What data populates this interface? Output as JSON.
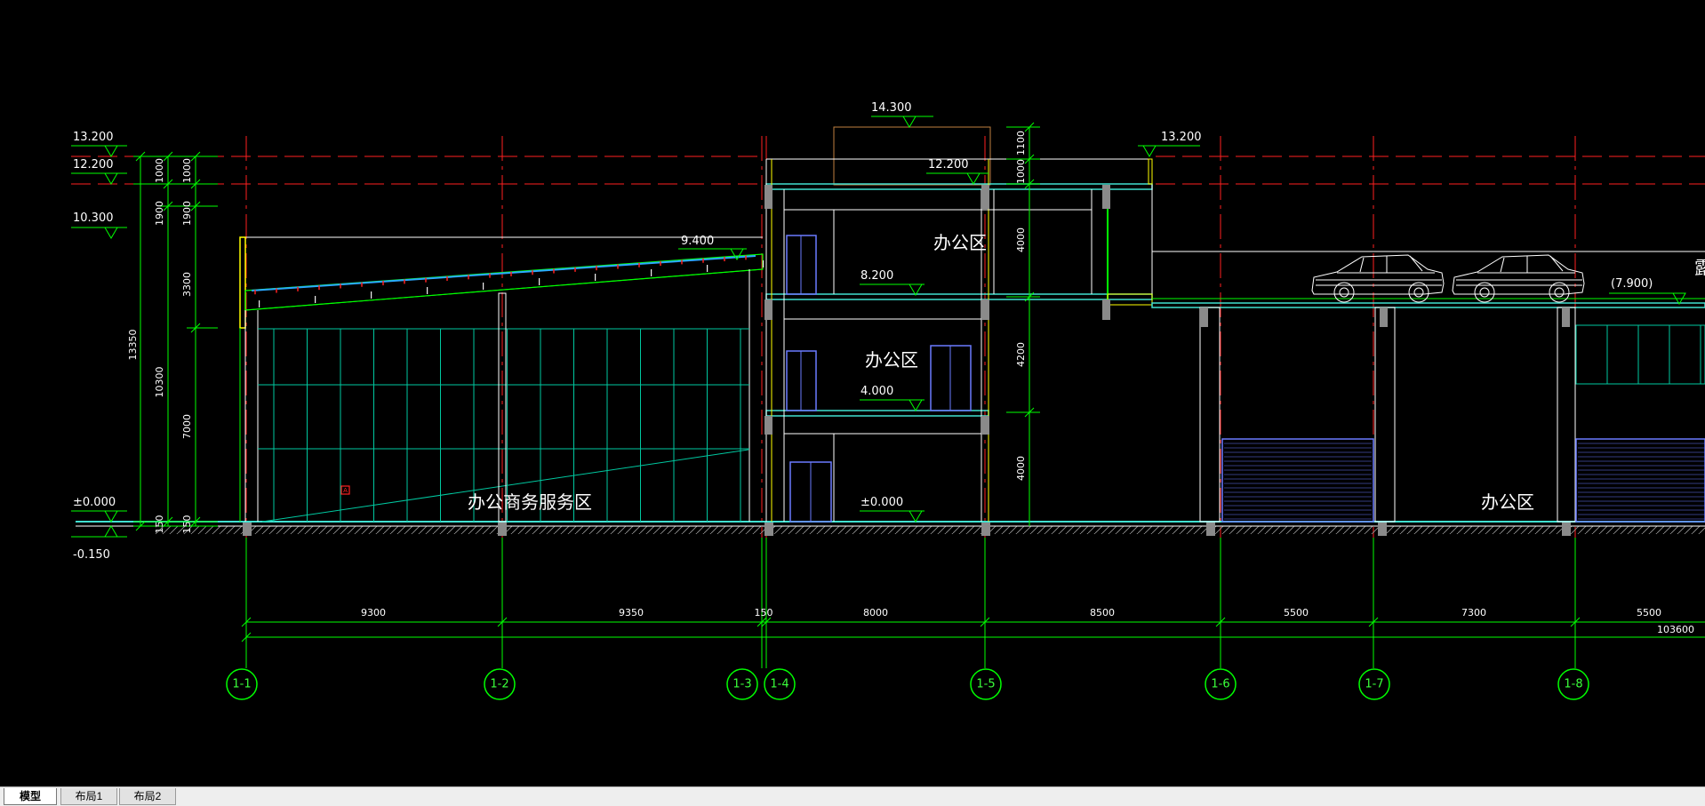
{
  "colors": {
    "background": "#000000",
    "axis_line": "#ff2020",
    "dim_line": "#00ff00",
    "wall": "#ffffff",
    "slab": "#40e0d0",
    "glazing": "#00c8a0",
    "window": "#6a7bff",
    "roof_beam": "#ffff00"
  },
  "levels": {
    "l_13200": "13.200",
    "l_12200": "12.200",
    "l_10300": "10.300",
    "l_0000": "±0.000",
    "l_m0150": "-0.150",
    "l_14300": "14.300",
    "l_12200_mid": "12.200",
    "l_13200_right": "13.200",
    "l_9400": "9.400",
    "l_8200": "8.200",
    "l_4000": "4.000",
    "l_0000_mid": "±0.000",
    "l_7900": "(7.900)"
  },
  "vertical_dims": {
    "total": "13350",
    "sub_10300": "10300",
    "d1000_a": "1000",
    "d1900_a": "1900",
    "d1000_b": "1000",
    "d1900_b": "1900",
    "d3300": "3300",
    "d7000": "7000",
    "d150_a": "150",
    "d150_b": "150",
    "mid_1100": "1100",
    "mid_1000": "1000",
    "mid_4000_top": "4000",
    "mid_4200": "4200",
    "mid_4000_bot": "4000"
  },
  "horizontal_dims": {
    "d9300": "9300",
    "d9350": "9350",
    "d150": "150",
    "d8000": "8000",
    "d8500": "8500",
    "d5500_a": "5500",
    "d7300": "7300",
    "d5500_b": "5500",
    "total": "103600"
  },
  "rooms": {
    "office_top": "办公区",
    "office_mid": "办公区",
    "business_zone": "办公商务服务区",
    "office_right": "办公区",
    "cut_text": "露"
  },
  "axes": [
    "1-1",
    "1-2",
    "1-3",
    "1-4",
    "1-5",
    "1-6",
    "1-7",
    "1-8"
  ],
  "layout_tabs": {
    "model": "模型",
    "layout1": "布局1",
    "layout2": "布局2"
  }
}
